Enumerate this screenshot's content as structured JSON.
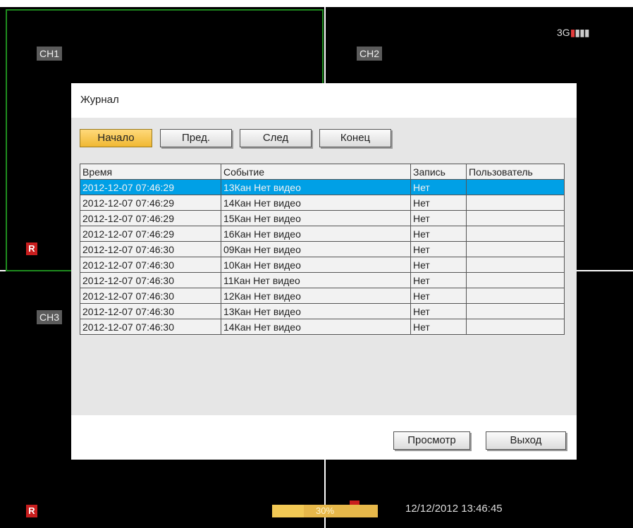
{
  "channels": {
    "ch1": "CH1",
    "ch2": "CH2",
    "ch3": "CH3"
  },
  "record_badge": "R",
  "signal": {
    "label": "3G",
    "icon": "signal-bars-icon"
  },
  "dialog": {
    "title": "Журнал",
    "nav": {
      "first": "Начало",
      "prev": "Пред.",
      "next": "След",
      "last": "Конец"
    },
    "columns": [
      "Время",
      "Событие",
      "Запись",
      "Пользователь"
    ],
    "rows": [
      {
        "time": "2012-12-07 07:46:29",
        "event": "13Кан Нет видео",
        "record": "Нет",
        "user": "",
        "selected": true
      },
      {
        "time": "2012-12-07 07:46:29",
        "event": "14Кан Нет видео",
        "record": "Нет",
        "user": ""
      },
      {
        "time": "2012-12-07 07:46:29",
        "event": "15Кан Нет видео",
        "record": "Нет",
        "user": ""
      },
      {
        "time": "2012-12-07 07:46:29",
        "event": "16Кан Нет видео",
        "record": "Нет",
        "user": ""
      },
      {
        "time": "2012-12-07 07:46:30",
        "event": "09Кан Нет видео",
        "record": "Нет",
        "user": ""
      },
      {
        "time": "2012-12-07 07:46:30",
        "event": "10Кан Нет видео",
        "record": "Нет",
        "user": ""
      },
      {
        "time": "2012-12-07 07:46:30",
        "event": "11Кан Нет видео",
        "record": "Нет",
        "user": ""
      },
      {
        "time": "2012-12-07 07:46:30",
        "event": "12Кан Нет видео",
        "record": "Нет",
        "user": ""
      },
      {
        "time": "2012-12-07 07:46:30",
        "event": "13Кан Нет видео",
        "record": "Нет",
        "user": ""
      },
      {
        "time": "2012-12-07 07:46:30",
        "event": "14Кан Нет видео",
        "record": "Нет",
        "user": ""
      }
    ],
    "view_button": "Просмотр",
    "exit_button": "Выход"
  },
  "status": {
    "progress_label": "30%",
    "progress_value": 0.3,
    "datetime": "12/12/2012 13:46:45"
  },
  "colors": {
    "selection": "#00a0e6",
    "active_button": "#f0b832",
    "record_red": "#c81e1e",
    "focus_green": "#1e8c1e"
  }
}
